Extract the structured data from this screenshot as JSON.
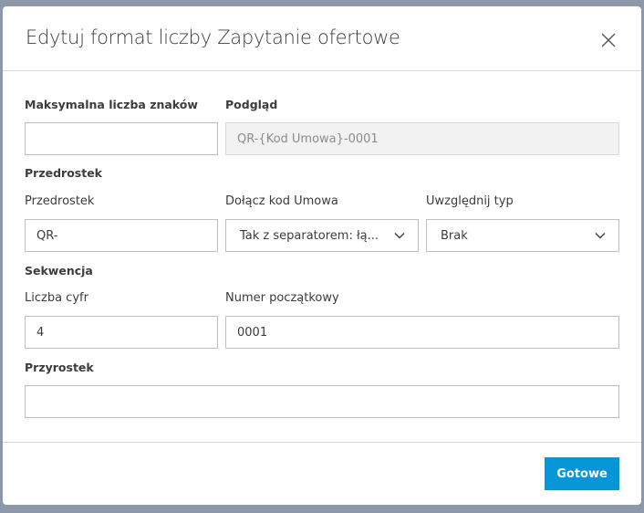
{
  "dialog": {
    "title": "Edytuj format liczby Zapytanie ofertowe"
  },
  "max_chars": {
    "label": "Maksymalna liczba znaków",
    "value": ""
  },
  "preview": {
    "label": "Podgląd",
    "value": "QR-{Kod Umowa}-0001"
  },
  "prefix_section": {
    "heading": "Przedrostek",
    "prefix": {
      "label": "Przedrostek",
      "value": "QR-"
    },
    "include_code": {
      "label": "Dołącz kod Umowa",
      "value": "Tak z separatorem: łą..."
    },
    "include_type": {
      "label": "Uwzględnij typ",
      "value": "Brak"
    }
  },
  "sequence": {
    "heading": "Sekwencja",
    "digits": {
      "label": "Liczba cyfr",
      "value": "4"
    },
    "start": {
      "label": "Numer początkowy",
      "value": "0001"
    }
  },
  "suffix": {
    "heading": "Przyrostek",
    "value": ""
  },
  "footer": {
    "done_label": "Gotowe"
  },
  "colors": {
    "accent": "#0696d7"
  }
}
